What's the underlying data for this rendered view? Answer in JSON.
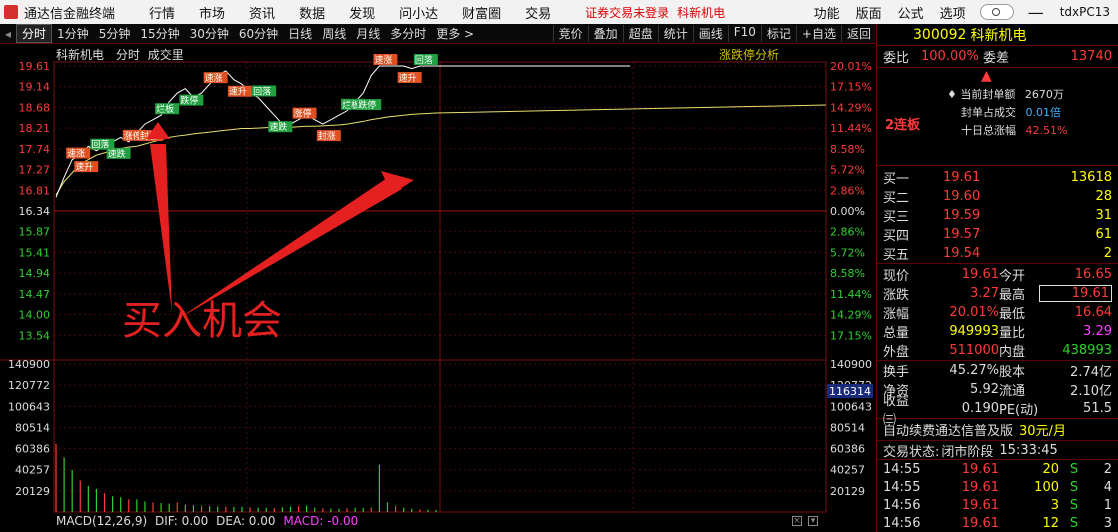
{
  "titlebar": {
    "app_name": "通达信金融终端",
    "menus": [
      "行情",
      "市场",
      "资讯",
      "数据",
      "发现",
      "问小达",
      "财富圈",
      "交易"
    ],
    "warning": "证券交易未登录",
    "stock_short": "科新机电",
    "right_menus": [
      "功能",
      "版面",
      "公式",
      "选项"
    ],
    "account": "tdxPC13"
  },
  "toolbar": {
    "periods": [
      "分时",
      "1分钟",
      "5分钟",
      "15分钟",
      "30分钟",
      "60分钟",
      "日线",
      "周线",
      "月线",
      "多分时",
      "更多 >"
    ],
    "tools": [
      "竞价",
      "叠加",
      "超盘",
      "统计",
      "画线",
      "F10",
      "标记",
      "+自选",
      "返回"
    ]
  },
  "chart": {
    "stock_name": "科新机电",
    "mode": "分时",
    "sub": "成交里",
    "analysis_label": "涨跌停分析",
    "price_ticks": [
      "19.61",
      "19.14",
      "18.68",
      "18.21",
      "17.74",
      "17.27",
      "16.81",
      "16.34",
      "15.87",
      "15.41",
      "14.94",
      "14.47",
      "14.00",
      "13.54"
    ],
    "pct_ticks": [
      "20.01%",
      "17.15%",
      "14.29%",
      "11.44%",
      "8.58%",
      "5.72%",
      "2.86%",
      "0.00%",
      "2.86%",
      "5.72%",
      "8.58%",
      "11.44%",
      "14.29%",
      "17.15%"
    ],
    "vol_ticks": [
      "140900",
      "120772",
      "100643",
      "80514",
      "60386",
      "40257",
      "20129"
    ],
    "vol_cursor": "116314",
    "annotation": "买入机会",
    "macd": {
      "name": "MACD(12,26,9)",
      "dif": "DIF: 0.00",
      "dea": "DEA: 0.00",
      "macd": "MACD: -0.00"
    },
    "tags": [
      "速涨",
      "速升",
      "回落",
      "速跌",
      "涨停",
      "封涨",
      "烂板",
      "跌停"
    ]
  },
  "chart_data": {
    "type": "line",
    "title": "科新机电 分时",
    "prev_close": 16.34,
    "ylim": [
      13.07,
      19.61
    ],
    "price_series": [
      16.65,
      17.1,
      17.5,
      17.6,
      17.8,
      17.7,
      17.8,
      17.9,
      18.0,
      17.9,
      18.1,
      18.3,
      18.4,
      18.5,
      18.8,
      19.0,
      19.1,
      18.9,
      19.0,
      19.2,
      19.4,
      19.5,
      19.3,
      19.2,
      19.0,
      18.9,
      18.7,
      18.5,
      18.3,
      18.3,
      18.4,
      18.5,
      18.4,
      18.3,
      18.4,
      18.5,
      18.6,
      18.8,
      19.0,
      19.4,
      19.61,
      19.61,
      19.61,
      19.61,
      19.55,
      19.61,
      19.61,
      19.61
    ],
    "avg_series": [
      16.7,
      17.0,
      17.2,
      17.4,
      17.5,
      17.6,
      17.65,
      17.7,
      17.75,
      17.78,
      17.8,
      17.85,
      17.9,
      17.95,
      18.0,
      18.03,
      18.05,
      18.08,
      18.1,
      18.12,
      18.14,
      18.16,
      18.18,
      18.2,
      18.2,
      18.21,
      18.22,
      18.22,
      18.23,
      18.23,
      18.24,
      18.25,
      18.25,
      18.26,
      18.27,
      18.28,
      18.3,
      18.33,
      18.36,
      18.4,
      18.43,
      18.46,
      18.48,
      18.5,
      18.52,
      18.53,
      18.54,
      18.55
    ],
    "volume_series": [
      65000,
      52000,
      40000,
      30000,
      25000,
      22000,
      18000,
      15000,
      14000,
      12000,
      12000,
      10000,
      9000,
      8500,
      8000,
      9000,
      7000,
      6500,
      6000,
      5500,
      5200,
      5000,
      4800,
      5000,
      4500,
      4200,
      4000,
      3800,
      4500,
      5000,
      5500,
      6000,
      4000,
      3500,
      3200,
      3000,
      3500,
      4000,
      3800,
      4200,
      45000,
      9000,
      6000,
      4000,
      3000,
      2500,
      2200,
      2000
    ]
  },
  "quote": {
    "code": "300092",
    "name": "科新机电",
    "weibi_label": "委比",
    "weibi": "100.00%",
    "weicha_label": "委差",
    "weicha": "13740",
    "seal_amt_label": "当前封单额",
    "seal_amt": "2670万",
    "seal_ratio_label": "封单占成交",
    "seal_ratio": "0.01倍",
    "ten_day_label": "十日总涨幅",
    "ten_day": "42.51%",
    "streak": "2连板",
    "buy": [
      {
        "label": "买一",
        "price": "19.61",
        "vol": "13618"
      },
      {
        "label": "买二",
        "price": "19.60",
        "vol": "28"
      },
      {
        "label": "买三",
        "price": "19.59",
        "vol": "31"
      },
      {
        "label": "买四",
        "price": "19.57",
        "vol": "61"
      },
      {
        "label": "买五",
        "price": "19.54",
        "vol": "2"
      }
    ],
    "stats": [
      {
        "l1": "现价",
        "v1": "19.61",
        "l2": "今开",
        "v2": "16.65"
      },
      {
        "l1": "涨跌",
        "v1": "3.27",
        "l2": "最高",
        "v2": "19.61"
      },
      {
        "l1": "涨幅",
        "v1": "20.01%",
        "l2": "最低",
        "v2": "16.64"
      },
      {
        "l1": "总量",
        "v1": "949993",
        "l2": "量比",
        "v2": "3.29"
      },
      {
        "l1": "外盘",
        "v1": "511000",
        "l2": "内盘",
        "v2": "438993"
      },
      {
        "l1": "换手",
        "v1": "45.27%",
        "l2": "股本",
        "v2": "2.74亿"
      },
      {
        "l1": "净资",
        "v1": "5.92",
        "l2": "流通",
        "v2": "2.10亿"
      },
      {
        "l1": "收益㈢",
        "v1": "0.190",
        "l2": "PE(动)",
        "v2": "51.5"
      }
    ],
    "promo": "自动续费通达信普及版",
    "promo_price": "30元/月",
    "status_label": "交易状态:",
    "status": "闭市阶段",
    "status_time": "15:33:45",
    "ticks": [
      {
        "t": "14:55",
        "p": "19.61",
        "v": "20",
        "s": "S",
        "n": "2"
      },
      {
        "t": "14:55",
        "p": "19.61",
        "v": "100",
        "s": "S",
        "n": "4"
      },
      {
        "t": "14:56",
        "p": "19.61",
        "v": "3",
        "s": "S",
        "n": "1"
      },
      {
        "t": "14:56",
        "p": "19.61",
        "v": "12",
        "s": "S",
        "n": "3"
      }
    ]
  }
}
